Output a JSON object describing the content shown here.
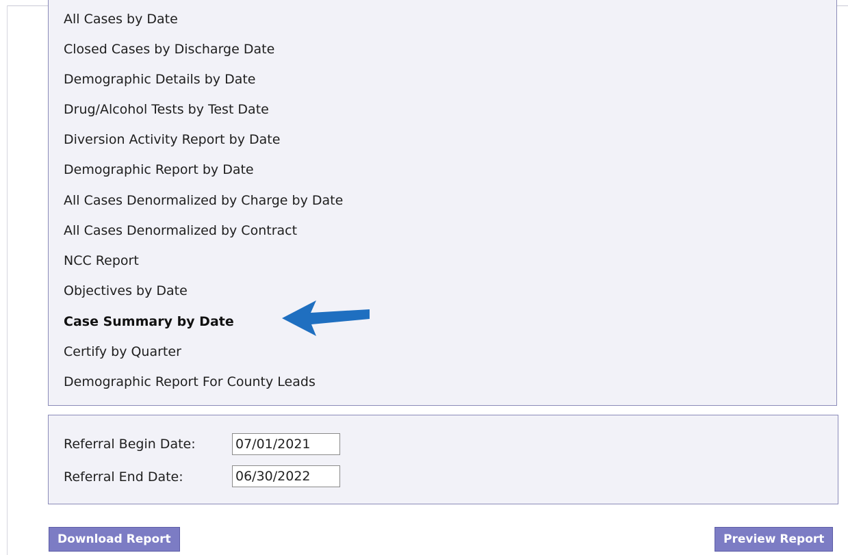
{
  "reports": {
    "items": [
      "All Cases by Date",
      "Closed Cases by Discharge Date",
      "Demographic Details by Date",
      "Drug/Alcohol Tests by Test Date",
      "Diversion Activity Report by Date",
      "Demographic Report by Date",
      "All Cases Denormalized by Charge by Date",
      "All Cases Denormalized by Contract",
      "NCC Report",
      "Objectives by Date",
      "Case Summary by Date",
      "Certify by Quarter",
      "Demographic Report For County Leads"
    ],
    "selected": "Case Summary by Date"
  },
  "annotation": {
    "arrow_color": "#1f6fc0",
    "icon": "arrow-left-icon"
  },
  "dates": {
    "begin_label": "Referral Begin Date:",
    "begin_value": "07/01/2021",
    "end_label": "Referral End Date:",
    "end_value": "06/30/2022"
  },
  "buttons": {
    "download": "Download Report",
    "preview": "Preview Report"
  },
  "colors": {
    "panel_bg": "#f2f2f8",
    "panel_border": "#8a8ab8",
    "button_bg": "#7c7cc4"
  }
}
